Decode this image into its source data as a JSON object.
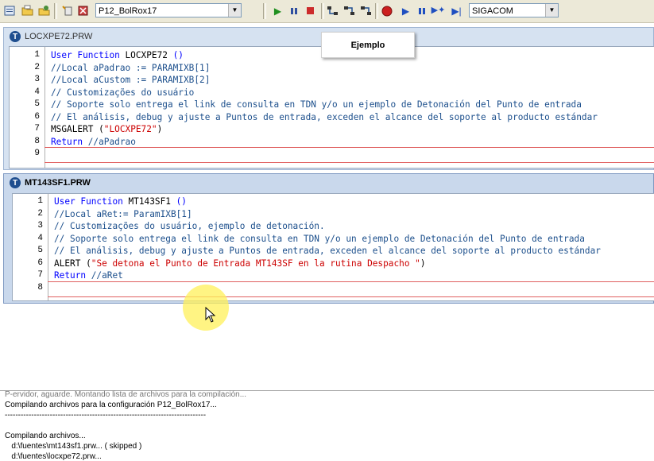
{
  "toolbar": {
    "environment_combo": "P12_BolRox17",
    "company_combo": "SIGACOM",
    "icons": [
      "compile-icon",
      "open-folder-icon",
      "project-icon",
      "sep",
      "bookmark-icon",
      "debug-icon",
      "sep",
      "run-icon",
      "pause-icon",
      "stop-icon",
      "sep",
      "step-into-icon",
      "step-over-icon",
      "step-out-icon",
      "sep",
      "breakpoint-icon",
      "play-icon",
      "pause2-icon",
      "step-icon",
      "run-to-cursor-icon"
    ]
  },
  "tooltip": {
    "text": "Ejemplo"
  },
  "editors": [
    {
      "title": "LOCXPE72.PRW",
      "lines": [
        {
          "n": "1",
          "segs": [
            {
              "t": "User Function",
              "c": "kw"
            },
            {
              "t": " LOCXPE72 ",
              "c": "fn"
            },
            {
              "t": "()",
              "c": "kw"
            }
          ]
        },
        {
          "n": "2",
          "segs": [
            {
              "t": "//Local aPadrao := PARAMIXB[1]",
              "c": "cm"
            }
          ]
        },
        {
          "n": "3",
          "segs": [
            {
              "t": "//Local aCustom := PARAMIXB[2]",
              "c": "cm"
            }
          ]
        },
        {
          "n": "4",
          "segs": [
            {
              "t": "// Customizações do usuário",
              "c": "cm"
            }
          ]
        },
        {
          "n": "5",
          "segs": [
            {
              "t": "// Soporte solo entrega el link de consulta en TDN y/o un ejemplo de Detonación del Punto de entrada",
              "c": "cm"
            }
          ]
        },
        {
          "n": "6",
          "segs": [
            {
              "t": "// El análisis, debug y ajuste a Puntos de entrada, exceden el alcance del soporte al producto estándar",
              "c": "cm"
            }
          ]
        },
        {
          "n": "7",
          "segs": [
            {
              "t": "MSGALERT (",
              "c": "pl"
            },
            {
              "t": "\"LOCXPE72\"",
              "c": "st"
            },
            {
              "t": ")",
              "c": "pl"
            }
          ]
        },
        {
          "n": "8",
          "segs": [
            {
              "t": "Return",
              "c": "kw"
            },
            {
              "t": " //aPadrao",
              "c": "cm"
            }
          ]
        },
        {
          "n": "9",
          "segs": []
        }
      ]
    },
    {
      "title": "MT143SF1.PRW",
      "lines": [
        {
          "n": "1",
          "segs": [
            {
              "t": "User Function",
              "c": "kw"
            },
            {
              "t": " MT143SF1 ",
              "c": "fn"
            },
            {
              "t": "()",
              "c": "kw"
            }
          ]
        },
        {
          "n": "2",
          "segs": [
            {
              "t": "//Local aRet:= ParamIXB[1]",
              "c": "cm"
            }
          ]
        },
        {
          "n": "3",
          "segs": [
            {
              "t": "// Customizações do usuário, ejemplo de detonación.",
              "c": "cm"
            }
          ]
        },
        {
          "n": "4",
          "segs": [
            {
              "t": "// Soporte solo entrega el link de consulta en TDN y/o un ejemplo de Detonación del Punto de entrada",
              "c": "cm"
            }
          ]
        },
        {
          "n": "5",
          "segs": [
            {
              "t": "// El análisis, debug y ajuste a Puntos de entrada, exceden el alcance del soporte al producto estándar",
              "c": "cm"
            }
          ]
        },
        {
          "n": "6",
          "segs": [
            {
              "t": "ALERT (",
              "c": "pl"
            },
            {
              "t": "\"Se detona el Punto de Entrada MT143SF en la rutina Despacho \"",
              "c": "st"
            },
            {
              "t": ")",
              "c": "pl"
            }
          ]
        },
        {
          "n": "7",
          "segs": [
            {
              "t": "Return",
              "c": "kw"
            },
            {
              "t": " //aRet",
              "c": "cm"
            }
          ]
        },
        {
          "n": "8",
          "segs": []
        }
      ]
    }
  ],
  "output": {
    "lines": [
      "P-ervidor, aguarde. Montando lista de archivos para la compilación...",
      "Compilando archivos para la configuración P12_BolRox17...",
      "----------------------------------------------------------------------------",
      "",
      "Compilando archivos...",
      "   d:\\fuentes\\mt143sf1.prw... ( skipped )",
      "   d:\\fuentes\\locxpe72.prw..."
    ]
  }
}
